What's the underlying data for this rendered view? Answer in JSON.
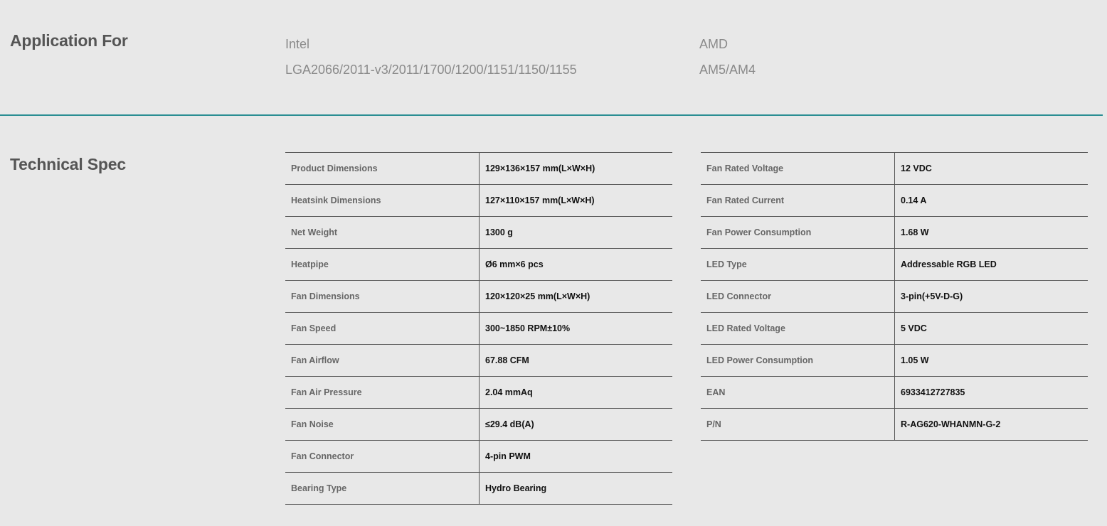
{
  "application": {
    "title": "Application For",
    "intel": {
      "vendor": "Intel",
      "sockets": "LGA2066/2011-v3/2011/1700/1200/1151/1150/1155"
    },
    "amd": {
      "vendor": "AMD",
      "sockets": "AM5/AM4"
    }
  },
  "colors": {
    "divider": "#2a8e93",
    "background": "#e8e8e8"
  },
  "spec": {
    "title": "Technical Spec",
    "left": [
      {
        "label": "Product Dimensions",
        "value": "129×136×157 mm(L×W×H)"
      },
      {
        "label": "Heatsink Dimensions",
        "value": "127×110×157 mm(L×W×H)"
      },
      {
        "label": "Net Weight",
        "value": "1300 g"
      },
      {
        "label": "Heatpipe",
        "value": "Ø6 mm×6 pcs"
      },
      {
        "label": "Fan Dimensions",
        "value": "120×120×25 mm(L×W×H)"
      },
      {
        "label": "Fan Speed",
        "value": "300~1850 RPM±10%"
      },
      {
        "label": "Fan Airflow",
        "value": "67.88 CFM"
      },
      {
        "label": "Fan Air Pressure",
        "value": "2.04 mmAq"
      },
      {
        "label": "Fan Noise",
        "value": "≤29.4 dB(A)"
      },
      {
        "label": "Fan Connector",
        "value": "4-pin PWM"
      },
      {
        "label": "Bearing Type",
        "value": "Hydro Bearing"
      }
    ],
    "right": [
      {
        "label": "Fan Rated Voltage",
        "value": "12 VDC"
      },
      {
        "label": "Fan Rated Current",
        "value": "0.14 A"
      },
      {
        "label": "Fan Power Consumption",
        "value": "1.68 W"
      },
      {
        "label": "LED Type",
        "value": "Addressable RGB LED"
      },
      {
        "label": "LED Connector",
        "value": "3-pin(+5V-D-G)"
      },
      {
        "label": "LED Rated Voltage",
        "value": "5 VDC"
      },
      {
        "label": "LED Power Consumption",
        "value": "1.05 W"
      },
      {
        "label": "EAN",
        "value": "6933412727835"
      },
      {
        "label": "P/N",
        "value": "R-AG620-WHANMN-G-2"
      }
    ]
  }
}
